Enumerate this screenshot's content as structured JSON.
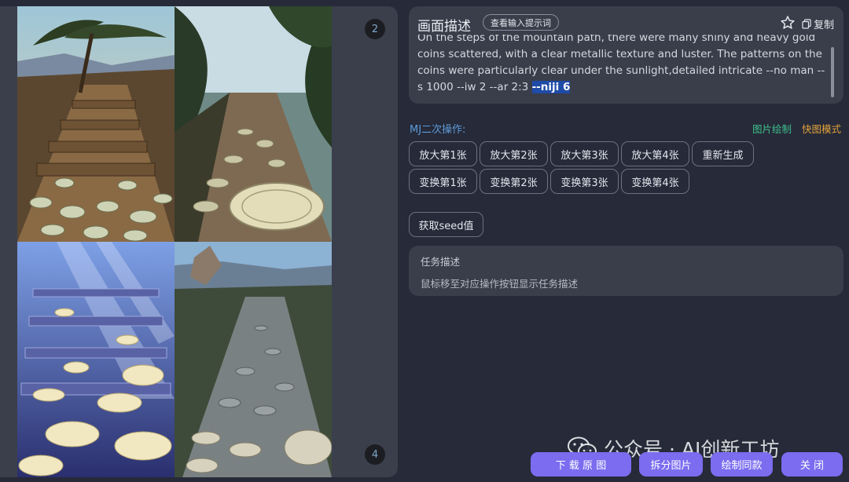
{
  "images": {
    "badge_top": "2",
    "badge_bottom": "4"
  },
  "description": {
    "title": "画面描述",
    "view_prompt_label": "查看输入提示词",
    "copy_label": "复制",
    "prompt_main": "On the steps of the mountain path, there were many shiny and heavy gold coins scattered, with a clear metallic texture and luster. The patterns on the coins were particularly clear under the sunlight,detailed intricate --no man --s 1000 --iw 2 --ar 2:3 ",
    "prompt_highlight": "--niji 6"
  },
  "mj_ops": {
    "label": "MJ二次操作:",
    "image_draw": "图片绘制",
    "quick_mode": "快图模式",
    "upscale": [
      "放大第1张",
      "放大第2张",
      "放大第3张",
      "放大第4张"
    ],
    "regenerate": "重新生成",
    "variation": [
      "变换第1张",
      "变换第2张",
      "变换第3张",
      "变换第4张"
    ],
    "seed": "获取seed值"
  },
  "task": {
    "title": "任务描述",
    "hint": "鼠标移至对应操作按钮显示任务描述"
  },
  "footer": {
    "download": "下 载 原 图",
    "split": "拆分图片",
    "draw_same": "绘制同款",
    "close": "关 闭"
  },
  "watermark": {
    "text": "公众号 · AI创新工坊"
  },
  "colors": {
    "accent": "#7b6cf0",
    "highlight": "#1f4ba8",
    "link_blue": "#5d9bd8",
    "green": "#3fbf8a",
    "orange": "#e2a23c"
  }
}
